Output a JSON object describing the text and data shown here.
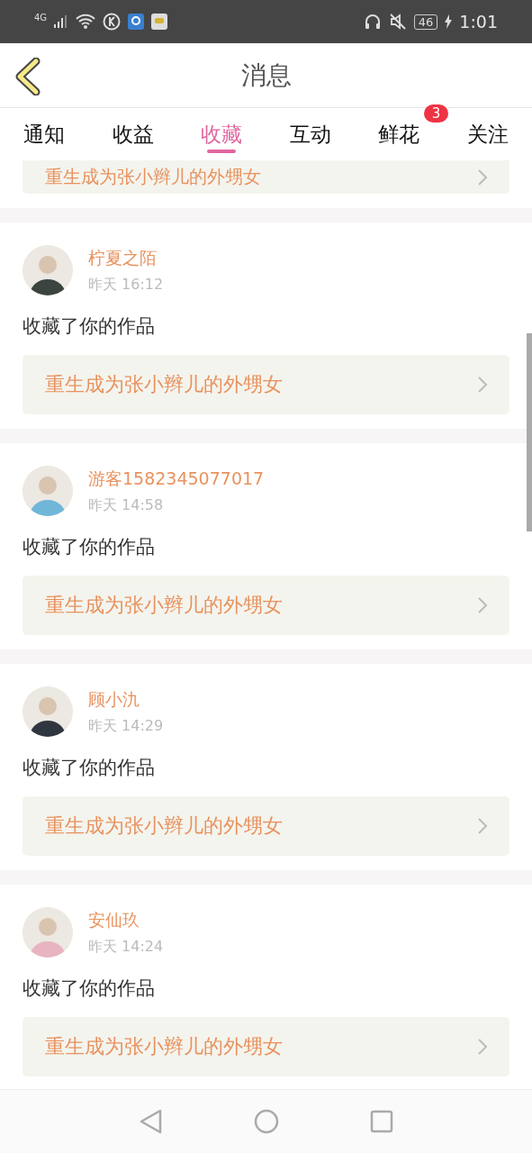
{
  "status_bar": {
    "network": "4G",
    "battery": "46",
    "time": "1:01"
  },
  "header": {
    "title": "消息"
  },
  "tabs": [
    {
      "label": "通知",
      "selected": false
    },
    {
      "label": "收益",
      "selected": false
    },
    {
      "label": "收藏",
      "selected": true
    },
    {
      "label": "互动",
      "selected": false
    },
    {
      "label": "鲜花",
      "selected": false,
      "badge": "3"
    },
    {
      "label": "关注",
      "selected": false
    }
  ],
  "partial_item": {
    "work": "重生成为张小辫儿的外甥女"
  },
  "items": [
    {
      "user": "柠夏之陌",
      "time": "昨天 16:12",
      "action": "收藏了你的作品",
      "work": "重生成为张小辫儿的外甥女"
    },
    {
      "user": "游客1582345077017",
      "time": "昨天 14:58",
      "action": "收藏了你的作品",
      "work": "重生成为张小辫儿的外甥女"
    },
    {
      "user": "顾小氿",
      "time": "昨天 14:29",
      "action": "收藏了你的作品",
      "work": "重生成为张小辫儿的外甥女"
    },
    {
      "user": "安仙玖",
      "time": "昨天 14:24",
      "action": "收藏了你的作品",
      "work": "重生成为张小辫儿的外甥女"
    }
  ]
}
